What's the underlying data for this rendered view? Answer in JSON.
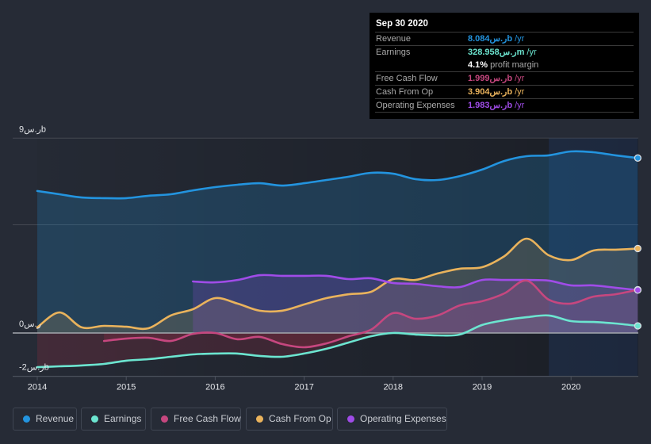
{
  "tooltip": {
    "date": "Sep 30 2020",
    "rows": [
      {
        "key": "revenue",
        "label": "Revenue",
        "value": "8.084ر.سb",
        "unit": " /yr"
      },
      {
        "key": "earnings",
        "label": "Earnings",
        "value": "328.958ر.سm",
        "unit": " /yr"
      },
      {
        "key": "margin",
        "label": "",
        "value": "4.1%",
        "unit": " profit margin"
      },
      {
        "key": "fcf",
        "label": "Free Cash Flow",
        "value": "1.999ر.سb",
        "unit": " /yr"
      },
      {
        "key": "cfo",
        "label": "Cash From Op",
        "value": "3.904ر.سb",
        "unit": " /yr"
      },
      {
        "key": "opex",
        "label": "Operating Expenses",
        "value": "1.983ر.سb",
        "unit": " /yr"
      }
    ],
    "colors": {
      "revenue": "#2394df",
      "earnings": "#6ce5d0",
      "margin_value": "#ffffff",
      "margin_text": "#a9a9a9",
      "fcf": "#c6477f",
      "cfo": "#eab35c",
      "opex": "#a04ce8"
    }
  },
  "legend": [
    {
      "label": "Revenue",
      "color": "#2394df"
    },
    {
      "label": "Earnings",
      "color": "#6ce5d0"
    },
    {
      "label": "Free Cash Flow",
      "color": "#c6477f"
    },
    {
      "label": "Cash From Op",
      "color": "#eab35c"
    },
    {
      "label": "Operating Expenses",
      "color": "#a04ce8"
    }
  ],
  "chart_data": {
    "type": "area",
    "title": "",
    "xlabel": "",
    "ylabel": "",
    "units": "ر.س b",
    "x": [
      2014.0,
      2014.25,
      2014.5,
      2014.75,
      2015.0,
      2015.25,
      2015.5,
      2015.75,
      2016.0,
      2016.25,
      2016.5,
      2016.75,
      2017.0,
      2017.25,
      2017.5,
      2017.75,
      2018.0,
      2018.25,
      2018.5,
      2018.75,
      2019.0,
      2019.25,
      2019.5,
      2019.75,
      2020.0,
      2020.25,
      2020.5,
      2020.75
    ],
    "xticks": [
      2014,
      2015,
      2016,
      2017,
      2018,
      2019,
      2020
    ],
    "xtick_labels": [
      "2014",
      "2015",
      "2016",
      "2017",
      "2018",
      "2019",
      "2020"
    ],
    "ylim": [
      -2,
      9
    ],
    "yticks": [
      {
        "value": 9,
        "label": "9ر.سb"
      },
      {
        "value": 0,
        "label": "0ر.س"
      },
      {
        "value": -2,
        "label": "-2ر.سb"
      }
    ],
    "grid": true,
    "grid_values": [
      9,
      5
    ],
    "highlight_range": [
      2019.75,
      2020.75
    ],
    "legend_position": "bottom",
    "series": [
      {
        "key": "revenue",
        "name": "Revenue",
        "color": "#2394df",
        "values": [
          6.56,
          6.41,
          6.26,
          6.23,
          6.23,
          6.34,
          6.41,
          6.59,
          6.74,
          6.85,
          6.92,
          6.81,
          6.92,
          7.07,
          7.22,
          7.4,
          7.36,
          7.11,
          7.07,
          7.25,
          7.55,
          7.95,
          8.17,
          8.21,
          8.39,
          8.35,
          8.21,
          8.084
        ]
      },
      {
        "key": "earnings",
        "name": "Earnings",
        "color": "#6ce5d0",
        "values": [
          -1.58,
          -1.54,
          -1.5,
          -1.43,
          -1.28,
          -1.21,
          -1.1,
          -0.99,
          -0.95,
          -0.95,
          -1.06,
          -1.1,
          -0.95,
          -0.73,
          -0.44,
          -0.15,
          0.0,
          -0.07,
          -0.11,
          -0.07,
          0.37,
          0.59,
          0.73,
          0.81,
          0.55,
          0.51,
          0.44,
          0.329
        ]
      },
      {
        "key": "fcf",
        "name": "Free Cash Flow",
        "color": "#c6477f",
        "values": [
          null,
          null,
          null,
          -0.37,
          -0.26,
          -0.22,
          -0.37,
          -0.04,
          0.0,
          -0.29,
          -0.18,
          -0.51,
          -0.66,
          -0.48,
          -0.15,
          0.15,
          0.92,
          0.66,
          0.81,
          1.28,
          1.47,
          1.83,
          2.42,
          1.54,
          1.36,
          1.68,
          1.79,
          1.999
        ]
      },
      {
        "key": "cfo",
        "name": "Cash From Op",
        "color": "#eab35c",
        "values": [
          0.26,
          0.95,
          0.26,
          0.33,
          0.29,
          0.22,
          0.81,
          1.1,
          1.61,
          1.36,
          1.03,
          1.03,
          1.32,
          1.61,
          1.79,
          1.9,
          2.49,
          2.45,
          2.75,
          2.97,
          3.04,
          3.55,
          4.36,
          3.59,
          3.37,
          3.81,
          3.85,
          3.904
        ]
      },
      {
        "key": "opex",
        "name": "Operating Expenses",
        "color": "#a04ce8",
        "values": [
          null,
          null,
          null,
          null,
          null,
          null,
          null,
          2.38,
          2.34,
          2.45,
          2.67,
          2.64,
          2.64,
          2.64,
          2.49,
          2.53,
          2.31,
          2.27,
          2.16,
          2.12,
          2.45,
          2.45,
          2.45,
          2.42,
          2.2,
          2.2,
          2.09,
          1.983
        ]
      }
    ]
  }
}
